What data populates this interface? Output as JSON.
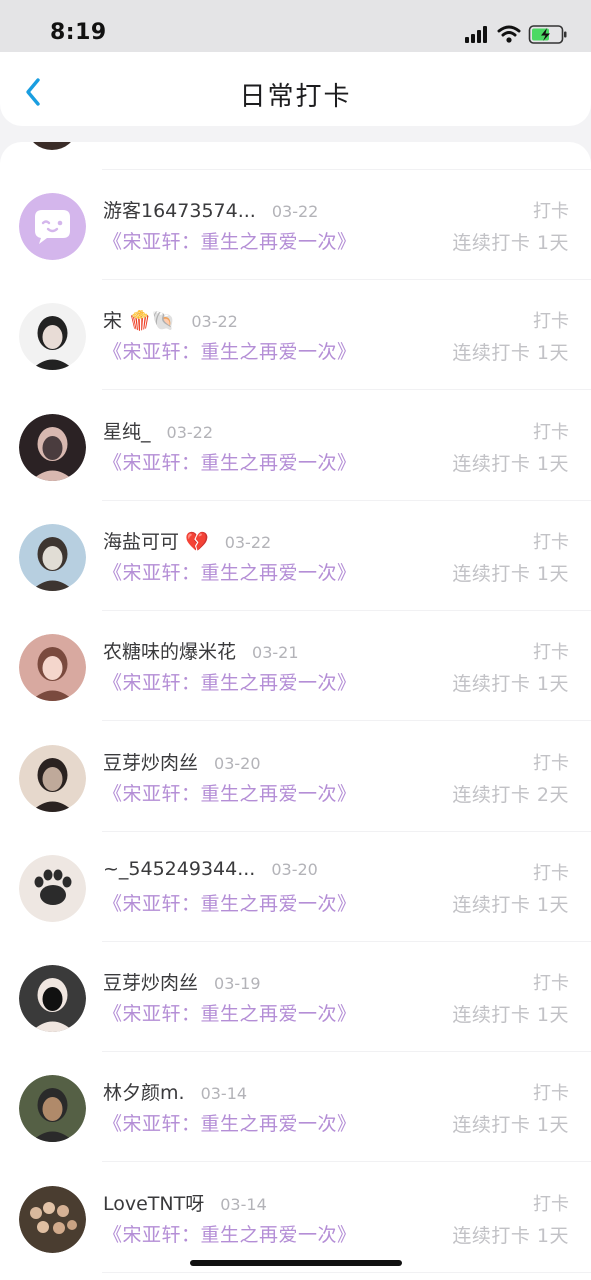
{
  "status_bar": {
    "time": "8:19"
  },
  "header": {
    "title": "日常打卡"
  },
  "entries": [
    {
      "name": "游客16473574...",
      "emoji": "",
      "date": "03-22",
      "book": "《宋亚轩：重生之再爱一次》",
      "type": "打卡",
      "streak": "连续打卡 1天",
      "avatar": "guest-avatar"
    },
    {
      "name": "宋",
      "emoji": "🍿🐚",
      "date": "03-22",
      "book": "《宋亚轩：重生之再爱一次》",
      "type": "打卡",
      "streak": "连续打卡 1天",
      "avatar": "user-avatar"
    },
    {
      "name": "星纯_",
      "emoji": "",
      "date": "03-22",
      "book": "《宋亚轩：重生之再爱一次》",
      "type": "打卡",
      "streak": "连续打卡 1天",
      "avatar": "user-avatar"
    },
    {
      "name": "海盐可可",
      "emoji": "💔",
      "date": "03-22",
      "book": "《宋亚轩：重生之再爱一次》",
      "type": "打卡",
      "streak": "连续打卡 1天",
      "avatar": "user-avatar"
    },
    {
      "name": "农糖味的爆米花",
      "emoji": "",
      "date": "03-21",
      "book": "《宋亚轩：重生之再爱一次》",
      "type": "打卡",
      "streak": "连续打卡 1天",
      "avatar": "user-avatar"
    },
    {
      "name": "豆芽炒肉丝",
      "emoji": "",
      "date": "03-20",
      "book": "《宋亚轩：重生之再爱一次》",
      "type": "打卡",
      "streak": "连续打卡 2天",
      "avatar": "user-avatar"
    },
    {
      "name": "~_545249344...",
      "emoji": "",
      "date": "03-20",
      "book": "《宋亚轩：重生之再爱一次》",
      "type": "打卡",
      "streak": "连续打卡 1天",
      "avatar": "paw-avatar"
    },
    {
      "name": "豆芽炒肉丝",
      "emoji": "",
      "date": "03-19",
      "book": "《宋亚轩：重生之再爱一次》",
      "type": "打卡",
      "streak": "连续打卡 1天",
      "avatar": "user-avatar"
    },
    {
      "name": "林夕颜m.",
      "emoji": "",
      "date": "03-14",
      "book": "《宋亚轩：重生之再爱一次》",
      "type": "打卡",
      "streak": "连续打卡 1天",
      "avatar": "user-avatar"
    },
    {
      "name": "LoveTNT呀",
      "emoji": "",
      "date": "03-14",
      "book": "《宋亚轩：重生之再爱一次》",
      "type": "打卡",
      "streak": "连续打卡 1天",
      "avatar": "group-avatar"
    }
  ],
  "colors": {
    "accent": "#1a9ee0",
    "book_title": "#b48ed6",
    "guest_avatar_bg": "#d4b6ec"
  }
}
